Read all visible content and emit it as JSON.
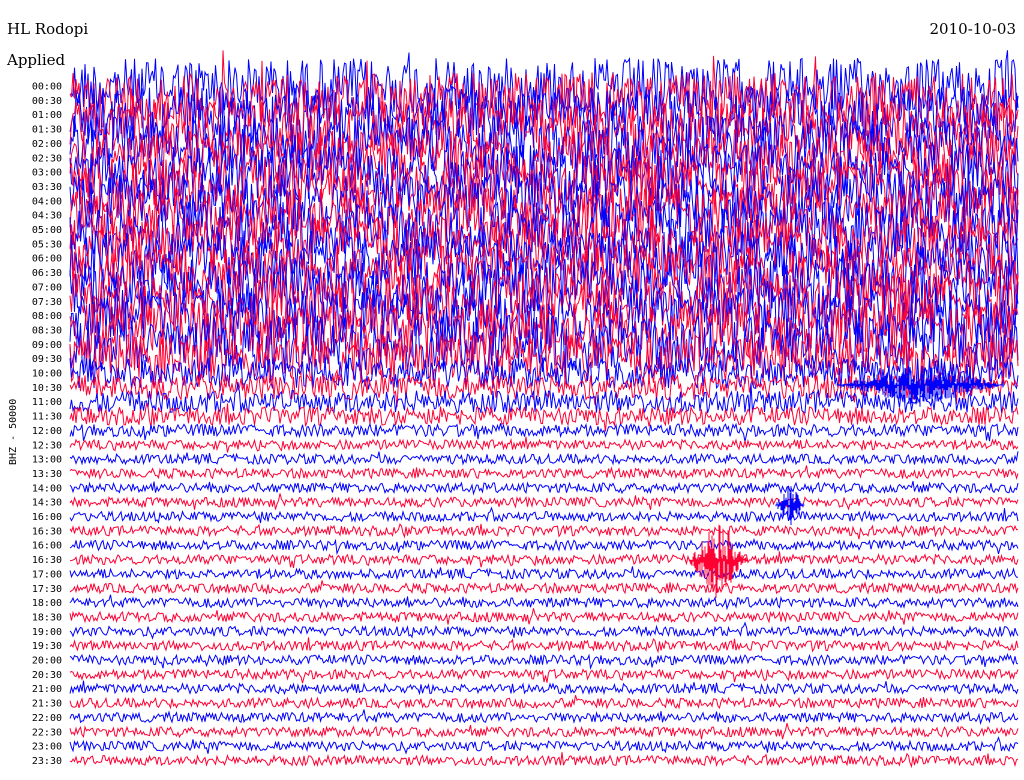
{
  "header": {
    "station": "HL Rodopi",
    "date": "2010-10-03",
    "filter": "Applied"
  },
  "chart_data": {
    "type": "line",
    "title": "HL Rodopi",
    "subtitle": "2010-10-03",
    "ylabel": "BHZ - 50000",
    "categories": [
      "00:00",
      "00:30",
      "01:00",
      "01:30",
      "02:00",
      "02:30",
      "03:00",
      "03:30",
      "04:00",
      "04:30",
      "05:00",
      "05:30",
      "06:00",
      "06:30",
      "07:00",
      "07:30",
      "08:00",
      "08:30",
      "09:00",
      "09:30",
      "10:00",
      "10:30",
      "11:00",
      "11:30",
      "12:00",
      "12:30",
      "13:00",
      "13:30",
      "14:00",
      "14:30",
      "15:00",
      "15:30",
      "16:00",
      "16:30",
      "17:00",
      "17:30",
      "18:00",
      "18:30",
      "19:00",
      "19:30",
      "20:00",
      "20:30",
      "21:00",
      "21:30",
      "22:00",
      "22:30",
      "23:00",
      "23:30"
    ],
    "tick_labels": [
      "00:00",
      "00:30",
      "01:00",
      "01:30",
      "02:00",
      "02:30",
      "03:00",
      "03:30",
      "04:00",
      "04:30",
      "05:00",
      "05:30",
      "06:00",
      "06:30",
      "07:00",
      "07:30",
      "08:00",
      "08:30",
      "09:00",
      "09:30",
      "10:00",
      "10:30",
      "11:00",
      "11:30",
      "12:00",
      "12:30",
      "13:00",
      "13:30",
      "14:00",
      "14:30",
      "16:00",
      "16:30",
      "16:00",
      "16:30",
      "17:00",
      "17:30",
      "18:00",
      "18:30",
      "19:00",
      "19:30",
      "20:00",
      "20:30",
      "21:00",
      "21:30",
      "22:00",
      "22:30",
      "23:00",
      "23:30"
    ],
    "relative_amplitude": [
      4.0,
      4.0,
      4.0,
      4.0,
      4.0,
      4.0,
      4.0,
      4.0,
      4.0,
      4.0,
      4.0,
      4.0,
      4.0,
      4.0,
      4.0,
      4.0,
      4.0,
      4.0,
      4.0,
      3.5,
      2.2,
      1.8,
      1.6,
      1.3,
      0.9,
      0.7,
      0.7,
      0.7,
      0.7,
      0.7,
      0.7,
      0.7,
      0.7,
      0.7,
      0.7,
      0.7,
      0.7,
      0.7,
      0.7,
      0.7,
      0.7,
      0.7,
      0.7,
      0.7,
      0.7,
      0.7,
      0.7,
      0.7
    ],
    "series_colors": [
      "#0000ff",
      "#ff0033"
    ],
    "trace_color": "#0000ff",
    "trace_alt_color": "#ff0033",
    "grid": false
  }
}
